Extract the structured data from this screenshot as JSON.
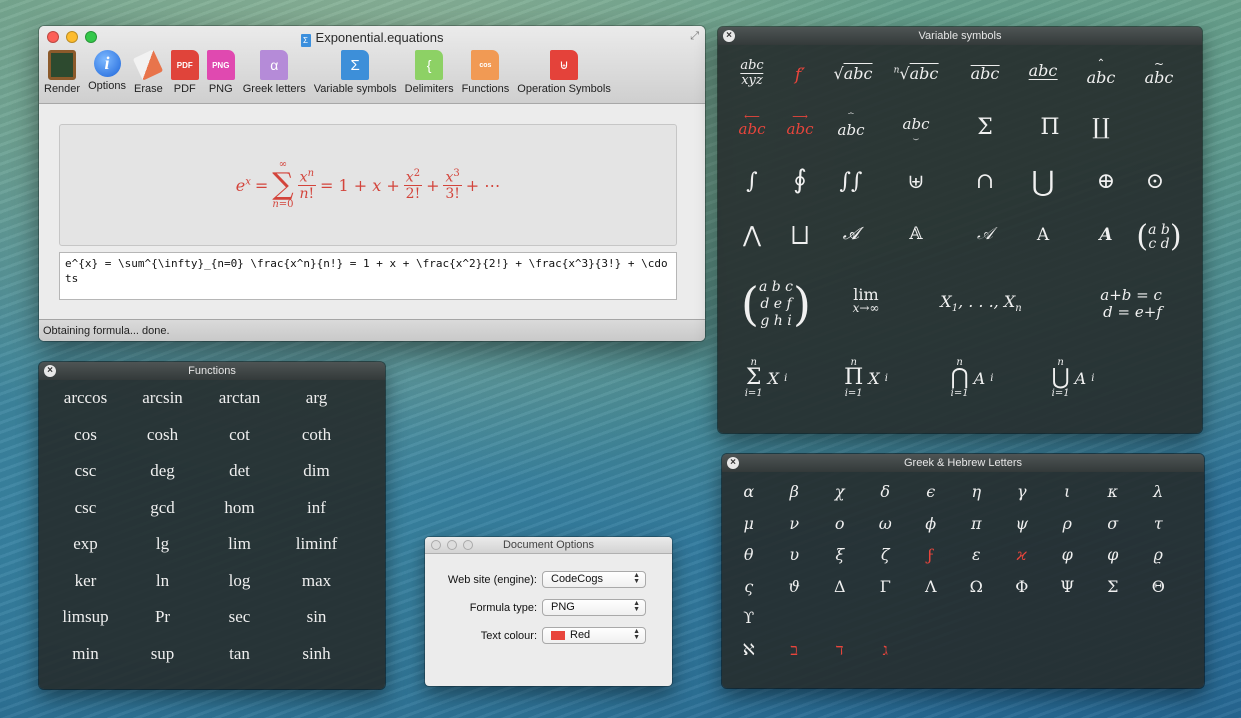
{
  "main_window": {
    "title": "Exponential.equations",
    "toolbar": [
      {
        "label": "Render",
        "icon": "render-icon",
        "glyph": ""
      },
      {
        "label": "Options",
        "icon": "info-icon",
        "glyph": "i"
      },
      {
        "label": "Erase",
        "icon": "eraser-icon",
        "glyph": ""
      },
      {
        "label": "PDF",
        "icon": "pdf-file-icon",
        "glyph": "PDF"
      },
      {
        "label": "PNG",
        "icon": "png-file-icon",
        "glyph": "PNG"
      },
      {
        "label": "Greek letters",
        "icon": "greek-file-icon",
        "glyph": "α"
      },
      {
        "label": "Variable symbols",
        "icon": "sigma-file-icon",
        "glyph": "Σ"
      },
      {
        "label": "Delimiters",
        "icon": "brace-file-icon",
        "glyph": "{"
      },
      {
        "label": "Functions",
        "icon": "cos-file-icon",
        "glyph": "cos"
      },
      {
        "label": "Operation Symbols",
        "icon": "union-file-icon",
        "glyph": "⊎"
      }
    ],
    "latex_source": "e^{x} = \\sum^{\\infty}_{n=0} \\frac{x^n}{n!} = 1 + x + \\frac{x^2}{2!} + \\frac{x^3}{3!} + \\cdots",
    "status": "Obtaining formula... done."
  },
  "variable_symbols": {
    "title": "Variable symbols"
  },
  "functions": {
    "title": "Functions",
    "items": [
      "arccos",
      "arcsin",
      "arctan",
      "arg",
      "cos",
      "cosh",
      "cot",
      "coth",
      "csc",
      "deg",
      "det",
      "dim",
      "csc",
      "gcd",
      "hom",
      "inf",
      "exp",
      "lg",
      "lim",
      "liminf",
      "ker",
      "ln",
      "log",
      "max",
      "limsup",
      "Pr",
      "sec",
      "sin",
      "min",
      "sup",
      "tan",
      "sinh"
    ]
  },
  "greek": {
    "title": "Greek & Hebrew Letters",
    "rows": [
      [
        "α",
        "β",
        "χ",
        "δ",
        "ϵ",
        "η",
        "γ",
        "ι",
        "κ",
        "λ"
      ],
      [
        "μ",
        "ν",
        "o",
        "ω",
        "ϕ",
        "π",
        "ψ",
        "ρ",
        "σ",
        "τ"
      ],
      [
        "θ",
        "υ",
        "ξ",
        "ζ",
        "ϝ",
        "ε",
        "ϰ",
        "φ",
        "φ",
        "ϱ"
      ],
      [
        "ς",
        "ϑ",
        "Δ",
        "Γ",
        "Λ",
        "Ω",
        "Φ",
        "Ψ",
        "Σ",
        "Θ"
      ],
      [
        "ϒ"
      ],
      [
        "ℵ",
        "ב",
        "ד",
        "ג"
      ]
    ]
  },
  "options": {
    "title": "Document Options",
    "rows": [
      {
        "label": "Web site (engine):",
        "value": "CodeCogs"
      },
      {
        "label": "Formula type:",
        "value": "PNG"
      },
      {
        "label": "Text colour:",
        "value": "Red"
      }
    ],
    "text_colour_hex": "#e8453c"
  },
  "colors": {
    "formula_red": "#d3443b",
    "hud_bg": "#262c2c"
  }
}
